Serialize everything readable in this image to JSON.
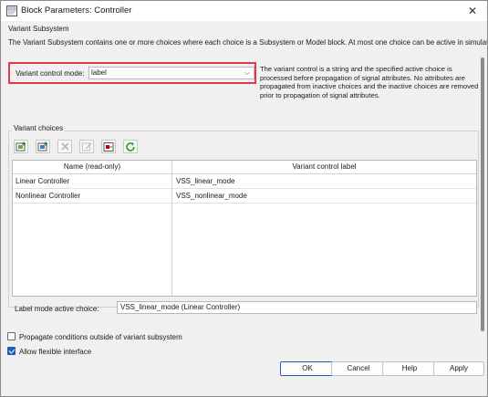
{
  "window": {
    "title": "Block Parameters: Controller"
  },
  "block": {
    "type_title": "Variant Subsystem",
    "description": "The Variant Subsystem contains one or more choices where each choice is a Subsystem or Model block. At most one choice can be active in simulation."
  },
  "variant_control_mode": {
    "label": "Variant control mode:",
    "value": "label",
    "help_text": "The variant control is a string and the specified active choice is processed before propagation of signal attributes. No attributes are propagated from inactive choices and the inactive choices are removed prior to propagation of signal attributes."
  },
  "variant_choices": {
    "title": "Variant choices",
    "toolbar": [
      {
        "name": "add-subsystem-choice-icon"
      },
      {
        "name": "add-model-choice-icon"
      },
      {
        "name": "delete-choice-icon"
      },
      {
        "name": "edit-choice-icon"
      },
      {
        "name": "open-block-icon"
      },
      {
        "name": "refresh-icon"
      }
    ],
    "columns": [
      "Name (read-only)",
      "Variant control label"
    ],
    "rows": [
      {
        "name": "Linear Controller",
        "label": "VSS_linear_mode"
      },
      {
        "name": "Nonlinear Controller",
        "label": "VSS_nonlinear_mode"
      }
    ]
  },
  "label_mode": {
    "label": "Label mode active choice:",
    "value": "VSS_linear_mode (Linear Controller)"
  },
  "options": {
    "propagate_label": "Propagate conditions outside of variant subsystem",
    "propagate_checked": false,
    "flexible_label": "Allow flexible interface",
    "flexible_checked": true
  },
  "buttons": {
    "ok": "OK",
    "cancel": "Cancel",
    "help": "Help",
    "apply": "Apply"
  },
  "colors": {
    "highlight": "#e63946",
    "accent": "#1f5fbf"
  }
}
